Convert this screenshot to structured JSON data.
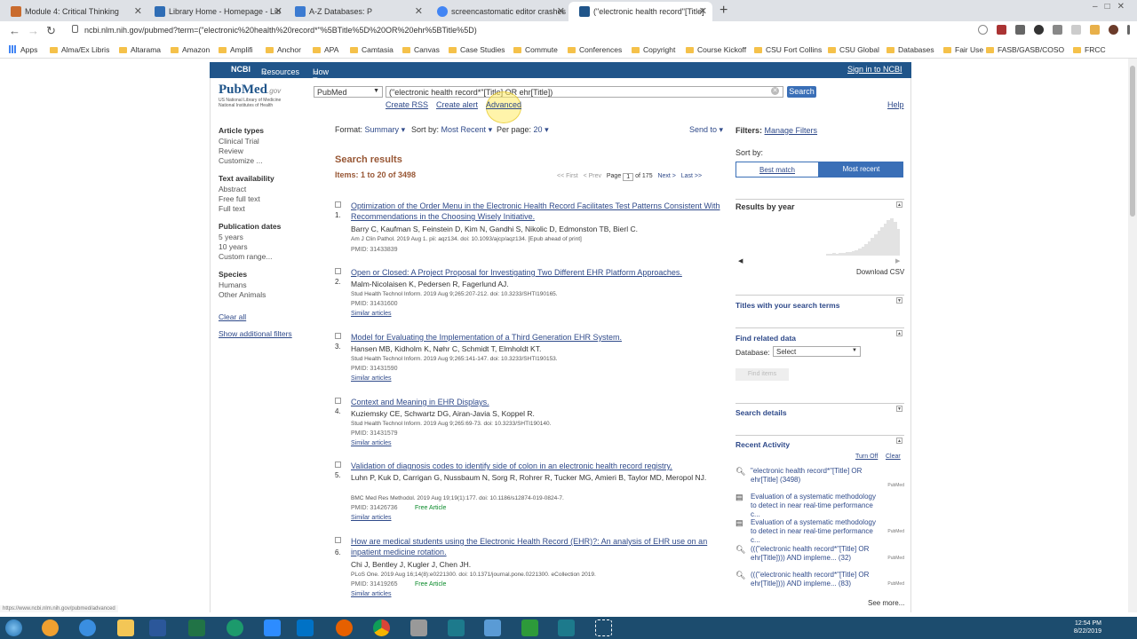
{
  "browser": {
    "tabs": [
      {
        "label": "Module 4: Critical Thinking",
        "color": "#c96b2e"
      },
      {
        "label": "Library Home - Homepage - Lib",
        "color": "#2f6db5"
      },
      {
        "label": "A-Z Databases: P",
        "color": "#3c7bd1"
      },
      {
        "label": "screencastomatic editor crashes",
        "color": "#4285f4"
      },
      {
        "label": "(\"electronic health record\"[Title]",
        "color": "#20558a"
      }
    ],
    "url": "ncbi.nlm.nih.gov/pubmed?term=(\"electronic%20health%20record*\"%5BTitle%5D%20OR%20ehr%5BTitle%5D)",
    "bookmarks": [
      "Apps",
      "Alma/Ex Libris",
      "Altarama",
      "Amazon",
      "Amplifi",
      "Anchor",
      "APA",
      "Camtasia",
      "Canvas",
      "Case Studies",
      "Commute",
      "Conferences",
      "Copyright",
      "Course Kickoff",
      "CSU Fort Collins",
      "CSU Global",
      "Databases",
      "Fair Use",
      "FASB/GASB/COSO",
      "FRCC"
    ],
    "status_url": "https://www.ncbi.nlm.nih.gov/pubmed/advanced"
  },
  "ncbi": {
    "brand": "NCBI",
    "resources": "Resources",
    "howto": "How To",
    "signin": "Sign in to NCBI"
  },
  "logo": {
    "name": "PubMed",
    "gov": ".gov",
    "sub1": "US National Library of Medicine",
    "sub2": "National Institutes of Health"
  },
  "search": {
    "db": "PubMed",
    "query": "(\"electronic health record*\"[Title] OR ehr[Title])",
    "button": "Search",
    "create_rss": "Create RSS",
    "create_alert": "Create alert",
    "advanced": "Advanced",
    "help": "Help"
  },
  "filters_left": {
    "article_types": "Article types",
    "article_items": [
      "Clinical Trial",
      "Review",
      "Customize ..."
    ],
    "text_avail": "Text availability",
    "text_items": [
      "Abstract",
      "Free full text",
      "Full text"
    ],
    "pub_dates": "Publication dates",
    "date_items": [
      "5 years",
      "10 years",
      "Custom range..."
    ],
    "species": "Species",
    "species_items": [
      "Humans",
      "Other Animals"
    ],
    "clear_all": "Clear all",
    "show_additional": "Show additional filters"
  },
  "toolbar": {
    "format_label": "Format:",
    "format_value": "Summary",
    "sort_label": "Sort by:",
    "sort_value": "Most Recent",
    "perpage_label": "Per page:",
    "perpage_value": "20",
    "send_to": "Send to"
  },
  "results": {
    "heading": "Search results",
    "items": "Items: 1 to 20 of 3498",
    "first": "<< First",
    "prev": "< Prev",
    "page_label": "Page",
    "page": "1",
    "of": "of 175",
    "next": "Next >",
    "last": "Last >>",
    "list": [
      {
        "num": "1.",
        "title": "Optimization of the Order Menu in the Electronic Health Record Facilitates Test Patterns Consistent With Recommendations in the Choosing Wisely Initiative.",
        "authors": "Barry C, Kaufman S, Feinstein D, Kim N, Gandhi S, Nikolic D, Edmonston TB, Bierl C.",
        "source": "Am J Clin Pathol. 2019 Aug 1. pii: aqz134. doi: 10.1093/ajcp/aqz134. [Epub ahead of print]",
        "pmid": "PMID: 31433839",
        "similar": "",
        "free": ""
      },
      {
        "num": "2.",
        "title": "Open or Closed: A Project Proposal for Investigating Two Different EHR Platform Approaches.",
        "authors": "Malm-Nicolaisen K, Pedersen R, Fagerlund AJ.",
        "source": "Stud Health Technol Inform. 2019 Aug 9;265:207-212. doi: 10.3233/SHTI190165.",
        "pmid": "PMID: 31431600",
        "similar": "Similar articles",
        "free": ""
      },
      {
        "num": "3.",
        "title": "Model for Evaluating the Implementation of a Third Generation EHR System.",
        "authors": "Hansen MB, Kidholm K, Nøhr C, Schmidt T, Elmholdt KT.",
        "source": "Stud Health Technol Inform. 2019 Aug 9;265:141-147. doi: 10.3233/SHTI190153.",
        "pmid": "PMID: 31431590",
        "similar": "Similar articles",
        "free": ""
      },
      {
        "num": "4.",
        "title": "Context and Meaning in EHR Displays.",
        "authors": "Kuziemsky CE, Schwartz DG, Airan-Javia S, Koppel R.",
        "source": "Stud Health Technol Inform. 2019 Aug 9;265:69-73. doi: 10.3233/SHTI190140.",
        "pmid": "PMID: 31431579",
        "similar": "Similar articles",
        "free": ""
      },
      {
        "num": "5.",
        "title": "Validation of diagnosis codes to identify side of colon in an electronic health record registry.",
        "authors": "Luhn P, Kuk D, Carrigan G, Nussbaum N, Sorg R, Rohrer R, Tucker MG, Amieri B, Taylor MD, Meropol NJ.",
        "source": "BMC Med Res Methodol. 2019 Aug 19;19(1):177. doi: 10.1186/s12874-019-0824-7.",
        "pmid": "PMID: 31426736",
        "similar": "Similar articles",
        "free": "Free Article"
      },
      {
        "num": "6.",
        "title": "How are medical students using the Electronic Health Record (EHR)?: An analysis of EHR use on an inpatient medicine rotation.",
        "authors": "Chi J, Bentley J, Kugler J, Chen JH.",
        "source": "PLoS One. 2019 Aug 16;14(8):e0221300. doi: 10.1371/journal.pone.0221300. eCollection 2019.",
        "pmid": "PMID: 31419265",
        "similar": "Similar articles",
        "free": "Free Article"
      }
    ]
  },
  "right": {
    "filters_label": "Filters:",
    "manage": "Manage Filters",
    "sort_by": "Sort by:",
    "best_match": "Best match",
    "most_recent": "Most recent",
    "results_by_year": "Results by year",
    "download_csv": "Download CSV",
    "titles_search": "Titles with your search terms",
    "find_related": "Find related data",
    "database_label": "Database:",
    "database_value": "Select",
    "find_items": "Find items",
    "search_details": "Search details",
    "recent_activity": "Recent Activity",
    "turn_off": "Turn Off",
    "clear": "Clear",
    "activity": [
      {
        "icon": "search",
        "text": "\"electronic health record*\"[Title] OR ehr[Title] (3498)",
        "db": "PubMed"
      },
      {
        "icon": "doc",
        "text": "Evaluation of a systematic methodology to detect in near real-time performance c...",
        "db": ""
      },
      {
        "icon": "doc",
        "text": "Evaluation of a systematic methodology to detect in near real-time performance c...",
        "db": "PubMed"
      },
      {
        "icon": "search",
        "text": "(((\"electronic health record*\"[Title] OR ehr[Title]))) AND impleme... (32)",
        "db": "PubMed"
      },
      {
        "icon": "search",
        "text": "(((\"electronic health record*\"[Title] OR ehr[Title]))) AND impleme... (83)",
        "db": "PubMed"
      }
    ],
    "see_more": "See more..."
  },
  "taskbar": {
    "time": "12:54 PM",
    "date": "8/22/2019"
  }
}
